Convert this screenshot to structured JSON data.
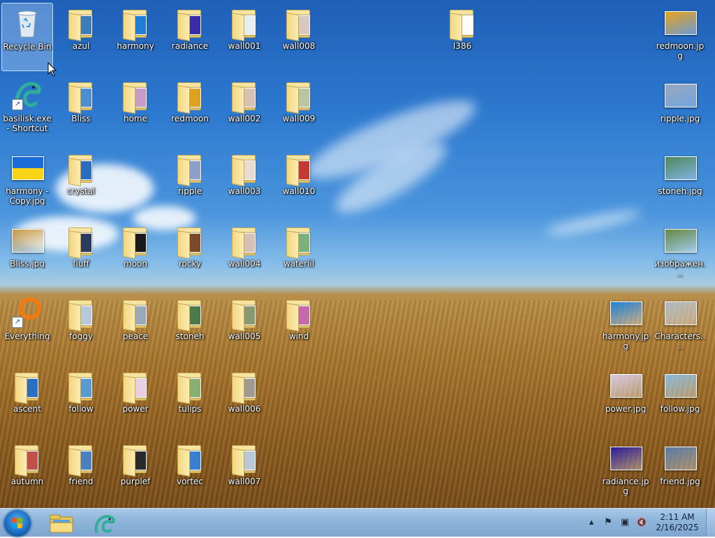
{
  "desktop": {
    "icons": [
      {
        "label": "Recycle Bin",
        "kind": "bin",
        "col": 0,
        "row": 0,
        "selected": true
      },
      {
        "label": "azul",
        "kind": "folder",
        "col": 1,
        "row": 0,
        "thumb": "#3b7db8"
      },
      {
        "label": "harmony",
        "kind": "folder",
        "col": 2,
        "row": 0,
        "thumb": "#1f7fd6"
      },
      {
        "label": "radiance",
        "kind": "folder",
        "col": 3,
        "row": 0,
        "thumb": "#3a2ba8"
      },
      {
        "label": "wall001",
        "kind": "folder",
        "col": 4,
        "row": 0,
        "thumb": "#e6eef4"
      },
      {
        "label": "wall008",
        "kind": "folder",
        "col": 5,
        "row": 0,
        "thumb": "#d9c8c0"
      },
      {
        "label": "I386",
        "kind": "folder-plain",
        "col": 8,
        "row": 0
      },
      {
        "label": "redmoon.jpg",
        "kind": "image",
        "col": 12,
        "row": 0,
        "thumb": "#e7a51d"
      },
      {
        "label": "basilisk.exe - Shortcut",
        "kind": "app-basilisk",
        "col": 0,
        "row": 1,
        "shortcut": true
      },
      {
        "label": "Bliss",
        "kind": "folder",
        "col": 1,
        "row": 1,
        "thumb": "#4c8ed0"
      },
      {
        "label": "home",
        "kind": "folder",
        "col": 2,
        "row": 1,
        "thumb": "#c79ac8"
      },
      {
        "label": "redmoon",
        "kind": "folder",
        "col": 3,
        "row": 1,
        "thumb": "#e0a020"
      },
      {
        "label": "wall002",
        "kind": "folder",
        "col": 4,
        "row": 1,
        "thumb": "#d8c3b2"
      },
      {
        "label": "wall009",
        "kind": "folder",
        "col": 5,
        "row": 1,
        "thumb": "#b9c7a0"
      },
      {
        "label": "ripple.jpg",
        "kind": "image",
        "col": 12,
        "row": 1,
        "thumb": "#9aa8c0"
      },
      {
        "label": "harmony - Copy.jpg",
        "kind": "image-flag",
        "col": 0,
        "row": 2
      },
      {
        "label": "crystal",
        "kind": "folder",
        "col": 1,
        "row": 2,
        "thumb": "#2a6dc0"
      },
      {
        "label": "ripple",
        "kind": "folder",
        "col": 3,
        "row": 2,
        "thumb": "#8ea0c8"
      },
      {
        "label": "wall003",
        "kind": "folder",
        "col": 4,
        "row": 2,
        "thumb": "#e8dcd0"
      },
      {
        "label": "wall010",
        "kind": "folder",
        "col": 5,
        "row": 2,
        "thumb": "#c43a32"
      },
      {
        "label": "stoneh.jpg",
        "kind": "image",
        "col": 12,
        "row": 2,
        "thumb": "#4f8a5a"
      },
      {
        "label": "Bliss.jpg",
        "kind": "image",
        "col": 0,
        "row": 3,
        "thumb": "#c99a45"
      },
      {
        "label": "fluff",
        "kind": "folder",
        "col": 1,
        "row": 3,
        "thumb": "#2a3a60"
      },
      {
        "label": "moon",
        "kind": "folder",
        "col": 2,
        "row": 3,
        "thumb": "#1a1a1a"
      },
      {
        "label": "rocky",
        "kind": "folder",
        "col": 3,
        "row": 3,
        "thumb": "#7a4a2a"
      },
      {
        "label": "wall004",
        "kind": "folder",
        "col": 4,
        "row": 3,
        "thumb": "#d8c0b8"
      },
      {
        "label": "waterlil",
        "kind": "folder",
        "col": 5,
        "row": 3,
        "thumb": "#7ab07a"
      },
      {
        "label": "изображен...",
        "kind": "image",
        "col": 12,
        "row": 3,
        "thumb": "#6a8a40"
      },
      {
        "label": "Everything",
        "kind": "app-everything",
        "col": 0,
        "row": 4,
        "shortcut": true
      },
      {
        "label": "foggy",
        "kind": "folder",
        "col": 1,
        "row": 4,
        "thumb": "#b8c8d8"
      },
      {
        "label": "peace",
        "kind": "folder",
        "col": 2,
        "row": 4,
        "thumb": "#9aa8b8"
      },
      {
        "label": "stoneh",
        "kind": "folder",
        "col": 3,
        "row": 4,
        "thumb": "#4e7a4a"
      },
      {
        "label": "wall005",
        "kind": "folder",
        "col": 4,
        "row": 4,
        "thumb": "#8a9a70"
      },
      {
        "label": "wind",
        "kind": "folder",
        "col": 5,
        "row": 4,
        "thumb": "#c46aa8"
      },
      {
        "label": "harmony.jpg",
        "kind": "image",
        "col": 11,
        "row": 4,
        "thumb": "#1d7fd8"
      },
      {
        "label": "Characters....",
        "kind": "image",
        "col": 12,
        "row": 4,
        "thumb": "#b0b8c0"
      },
      {
        "label": "ascent",
        "kind": "folder",
        "col": 0,
        "row": 5,
        "thumb": "#2a70c0"
      },
      {
        "label": "follow",
        "kind": "folder",
        "col": 1,
        "row": 5,
        "thumb": "#5a9ad0"
      },
      {
        "label": "power",
        "kind": "folder",
        "col": 2,
        "row": 5,
        "thumb": "#e8d0e0"
      },
      {
        "label": "tulips",
        "kind": "folder",
        "col": 3,
        "row": 5,
        "thumb": "#8ab070"
      },
      {
        "label": "wall006",
        "kind": "folder",
        "col": 4,
        "row": 5,
        "thumb": "#a09a90"
      },
      {
        "label": "power.jpg",
        "kind": "image",
        "col": 11,
        "row": 5,
        "thumb": "#d8c8e0"
      },
      {
        "label": "follow.jpg",
        "kind": "image",
        "col": 12,
        "row": 5,
        "thumb": "#8ab8d8"
      },
      {
        "label": "autumn",
        "kind": "folder",
        "col": 0,
        "row": 6,
        "thumb": "#c0504a"
      },
      {
        "label": "friend",
        "kind": "folder",
        "col": 1,
        "row": 6,
        "thumb": "#4a80c0"
      },
      {
        "label": "purplef",
        "kind": "folder",
        "col": 2,
        "row": 6,
        "thumb": "#2a2a2a"
      },
      {
        "label": "vortec",
        "kind": "folder",
        "col": 3,
        "row": 6,
        "thumb": "#3a80d0"
      },
      {
        "label": "wall007",
        "kind": "folder",
        "col": 4,
        "row": 6,
        "thumb": "#b8c8d8"
      },
      {
        "label": "radiance.jpg",
        "kind": "image",
        "col": 11,
        "row": 6,
        "thumb": "#2a1a9a"
      },
      {
        "label": "friend.jpg",
        "kind": "image",
        "col": 12,
        "row": 6,
        "thumb": "#5a7aa8"
      }
    ]
  },
  "taskbar": {
    "pinned": [
      {
        "name": "explorer-taskbar-button",
        "icon": "folder-icon"
      },
      {
        "name": "basilisk-taskbar-button",
        "icon": "basilisk-icon"
      }
    ],
    "tray": {
      "chevron": "▴",
      "flag": "⚑",
      "network": "▣",
      "volume": "🔇",
      "time": "2:11 AM",
      "date": "2/16/2025"
    }
  },
  "colors": {
    "taskbar": "#8fb5da",
    "folder": "#f0d27a",
    "start": "#1c6fc4"
  }
}
